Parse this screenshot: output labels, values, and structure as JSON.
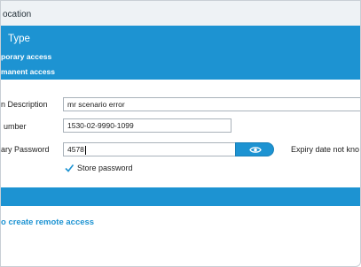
{
  "window": {
    "title": "ocation"
  },
  "banner": {
    "title": "Type",
    "options": [
      "porary access",
      "manent access"
    ]
  },
  "form": {
    "description": {
      "label": "n Description",
      "value": "mr scenario error"
    },
    "number": {
      "label": "umber",
      "value": "1530-02-9990-1099"
    },
    "password": {
      "label": "ary Password",
      "value": "4578",
      "expiry_text": "Expiry date not kno"
    },
    "store_password": {
      "label": "Store password",
      "checked": true
    }
  },
  "footer": {
    "link_text": "o create remote access"
  },
  "colors": {
    "accent": "#1d93d2",
    "link": "#1d93d2"
  },
  "icons": {
    "reveal": "eye-icon",
    "check": "check-icon"
  }
}
